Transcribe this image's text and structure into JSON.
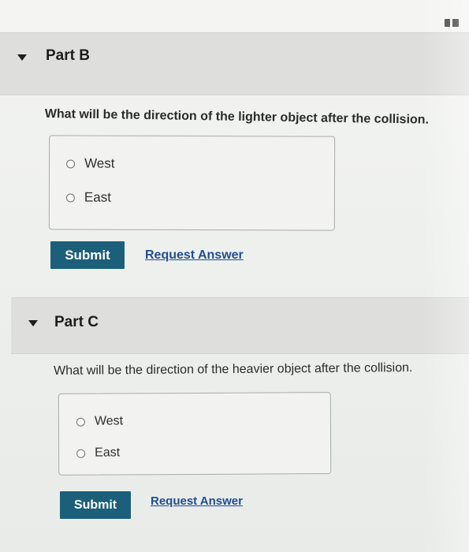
{
  "colors": {
    "submit_background": "#1b5f7a",
    "link": "#1f4e8f",
    "header_band": "#dedfdd"
  },
  "parts": [
    {
      "title": "Part B",
      "question": "What will be the direction of the lighter object after the collision.",
      "options": [
        {
          "label": "West",
          "selected": false
        },
        {
          "label": "East",
          "selected": false
        }
      ],
      "submit_label": "Submit",
      "request_answer_label": "Request Answer"
    },
    {
      "title": "Part C",
      "question": "What will be the direction of the heavier object after the collision.",
      "options": [
        {
          "label": "West",
          "selected": false
        },
        {
          "label": "East",
          "selected": false
        }
      ],
      "submit_label": "Submit",
      "request_answer_label": "Request Answer"
    }
  ]
}
